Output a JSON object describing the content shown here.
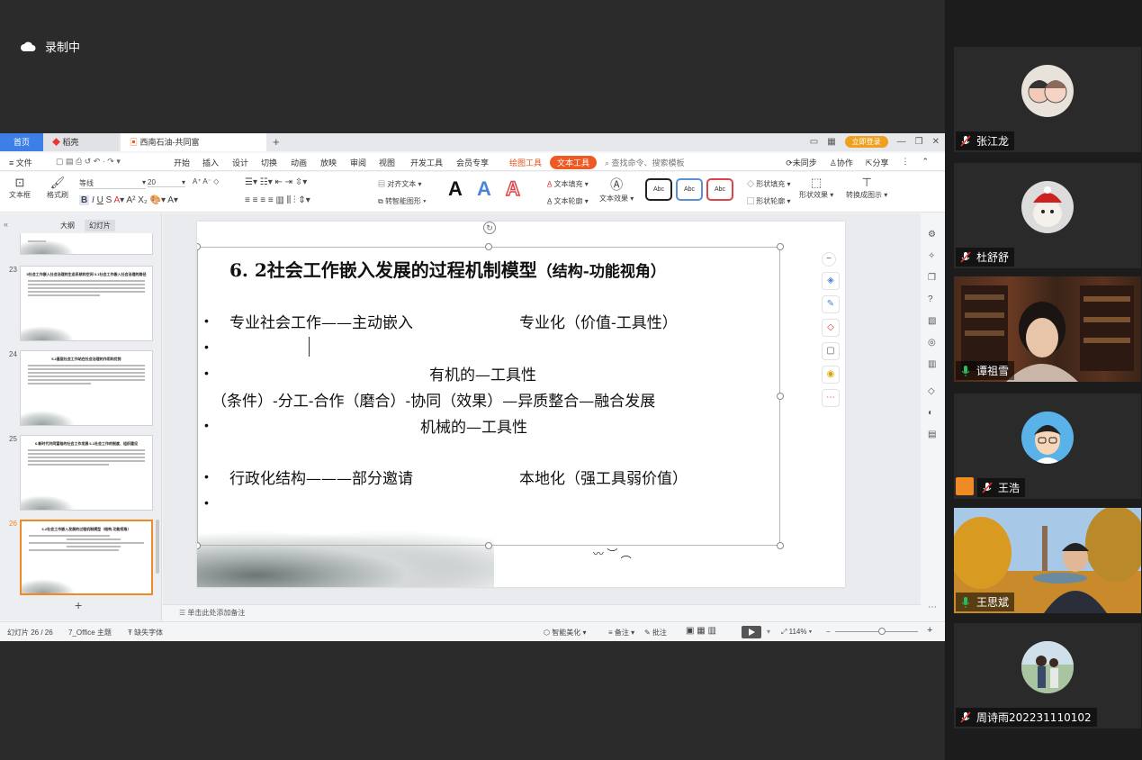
{
  "meeting": {
    "recording_label": "录制中"
  },
  "window": {
    "tabs": {
      "home": "首页",
      "daoke": "稻壳",
      "file": "西南石油-共同富裕.ppt"
    },
    "login": "立即登录",
    "menus": [
      "文件",
      "开始",
      "插入",
      "设计",
      "切换",
      "动画",
      "放映",
      "审阅",
      "视图",
      "开发工具",
      "会员专享",
      "绘图工具",
      "文本工具"
    ],
    "search_placeholder": "查找命令、搜索模板",
    "menu_right": [
      "未同步",
      "协作",
      "分享"
    ]
  },
  "ribbon": {
    "textbox": "文本框",
    "format_brush": "格式刷",
    "font_name": "等线",
    "font_size": "20",
    "align_text": "对齐文本",
    "smartart": "转智能图形",
    "text_fill": "文本填充",
    "text_outline": "文本轮廓",
    "text_effect": "文本效果",
    "shape_fill": "形状填充",
    "shape_outline": "形状轮廓",
    "shape_effect": "形状效果",
    "to_diagram": "转换成图示",
    "abc": "Abc",
    "bigA": "A"
  },
  "panel": {
    "tab_outline": "大纲",
    "tab_slides": "幻灯片"
  },
  "thumbnails": [
    {
      "num": "23",
      "title": "5社会工作嵌入社会治理的生态系统和空间\n5.1社会工作嵌入社会治理的路径"
    },
    {
      "num": "24",
      "title": "5.2基层社会工作站在社会治理的作用和优势"
    },
    {
      "num": "25",
      "title": "6.新时代共同富裕的社会工作发展\n6.1社会工作的制度、组织建设"
    },
    {
      "num": "26",
      "title": "6.2社会工作嵌入发展的过程机制模型（结构-功能视角）"
    }
  ],
  "slide": {
    "title": "6. 2社会工作嵌入发展的过程机制模型",
    "title_suffix": "（结构-功能视角）",
    "line1_left": "专业社会工作——主动嵌入",
    "line1_right": "专业化（价值-工具性）",
    "organic": "有机的—工具性",
    "chain": "（条件）-分工-合作（磨合）-协同（效果）—异质整合—融合发展",
    "mechanical": "机械的—工具性",
    "line2_left": "行政化结构———部分邀请",
    "line2_right": "本地化（强工具弱价值）",
    "bullet": "•"
  },
  "notes_placeholder": "单击此处添加备注",
  "status": {
    "slide_counter": "幻灯片 26 / 26",
    "theme": "7_Office 主题",
    "missing_font": "缺失字体",
    "beautify": "智能美化",
    "notes": "备注",
    "comments": "批注",
    "zoom": "114%"
  },
  "participants": [
    {
      "name": "张江龙",
      "mic": "muted",
      "kind": "avatar"
    },
    {
      "name": "杜舒舒",
      "mic": "muted",
      "kind": "avatar"
    },
    {
      "name": "谭祖雪",
      "mic": "on",
      "kind": "video"
    },
    {
      "name": "王浩",
      "mic": "muted",
      "kind": "avatar",
      "host": true
    },
    {
      "name": "王思斌",
      "mic": "on",
      "kind": "video"
    },
    {
      "name": "周诗雨202231110102",
      "mic": "muted",
      "kind": "avatar"
    }
  ],
  "colors": {
    "accent_orange": "#ee5a24",
    "wps_blue": "#3d7fe6",
    "active_speaker": "#2bbd5e"
  }
}
